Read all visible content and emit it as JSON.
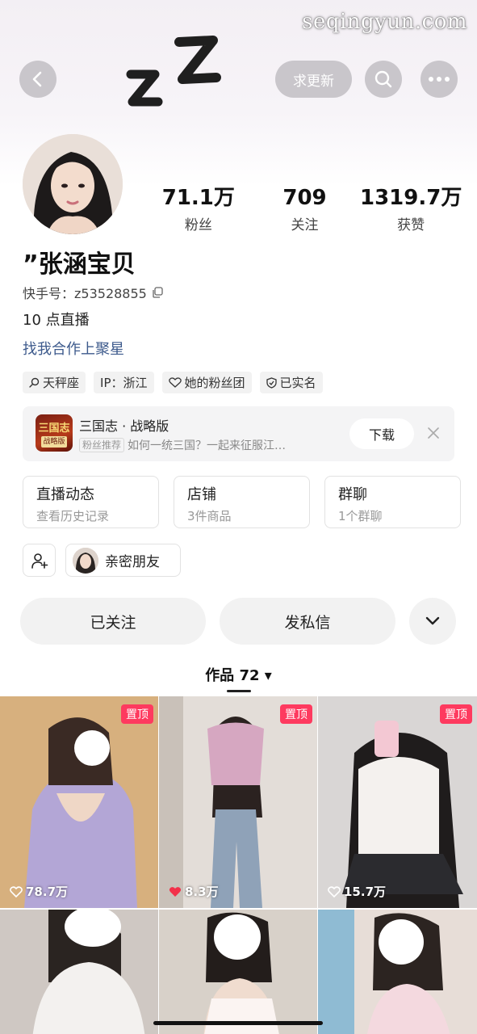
{
  "watermark": "seqingyun.com",
  "header": {
    "update_label": "求更新"
  },
  "profile": {
    "name": "”张涵宝贝",
    "kuaishou_id": "快手号：z53528855",
    "bio": "10 点直播",
    "collab_link": "找我合作上聚星"
  },
  "stats": [
    {
      "value": "71.1万",
      "label": "粉丝"
    },
    {
      "value": "709",
      "label": "关注"
    },
    {
      "value": "1319.7万",
      "label": "获赞"
    }
  ],
  "tags": [
    {
      "icon": "search-icon",
      "text": "天秤座"
    },
    {
      "icon": "",
      "text": "IP：浙江"
    },
    {
      "icon": "heart-outline-icon",
      "text": "她的粉丝团"
    },
    {
      "icon": "shield-check-icon",
      "text": "已实名"
    }
  ],
  "ad": {
    "title": "三国志 · 战略版",
    "icon_text_top": "三国志",
    "icon_text_bottom": "战略版",
    "badge": "粉丝推荐",
    "subtitle": "如何一统三国？一起来征服江…",
    "download_label": "下载"
  },
  "cards": [
    {
      "title": "直播动态",
      "subtitle": "查看历史记录"
    },
    {
      "title": "店铺",
      "subtitle": "3件商品"
    },
    {
      "title": "群聊",
      "subtitle": "1个群聊"
    }
  ],
  "close_friends_label": "亲密朋友",
  "actions": {
    "follow_label": "已关注",
    "message_label": "发私信"
  },
  "works_tab": {
    "label": "作品 72 ▾"
  },
  "posts": [
    {
      "pinned": "置顶",
      "likes": "78.7万",
      "liked": false,
      "bg": "#d9b384"
    },
    {
      "pinned": "置顶",
      "likes": "8.3万",
      "liked": true,
      "bg": "#c8bfb8"
    },
    {
      "pinned": "置顶",
      "likes": "15.7万",
      "liked": false,
      "bg": "#d7d4d3"
    },
    {
      "pinned": "",
      "likes": "",
      "liked": false,
      "bg": "#c9c2bd"
    },
    {
      "pinned": "",
      "likes": "",
      "liked": false,
      "bg": "#cbbfb4"
    },
    {
      "pinned": "",
      "likes": "",
      "liked": false,
      "bg": "#8fb9cf"
    }
  ],
  "colors": {
    "accent_pink": "#fe3a5f",
    "link_blue": "#3d5a8c",
    "heart_red": "#f2314a"
  }
}
